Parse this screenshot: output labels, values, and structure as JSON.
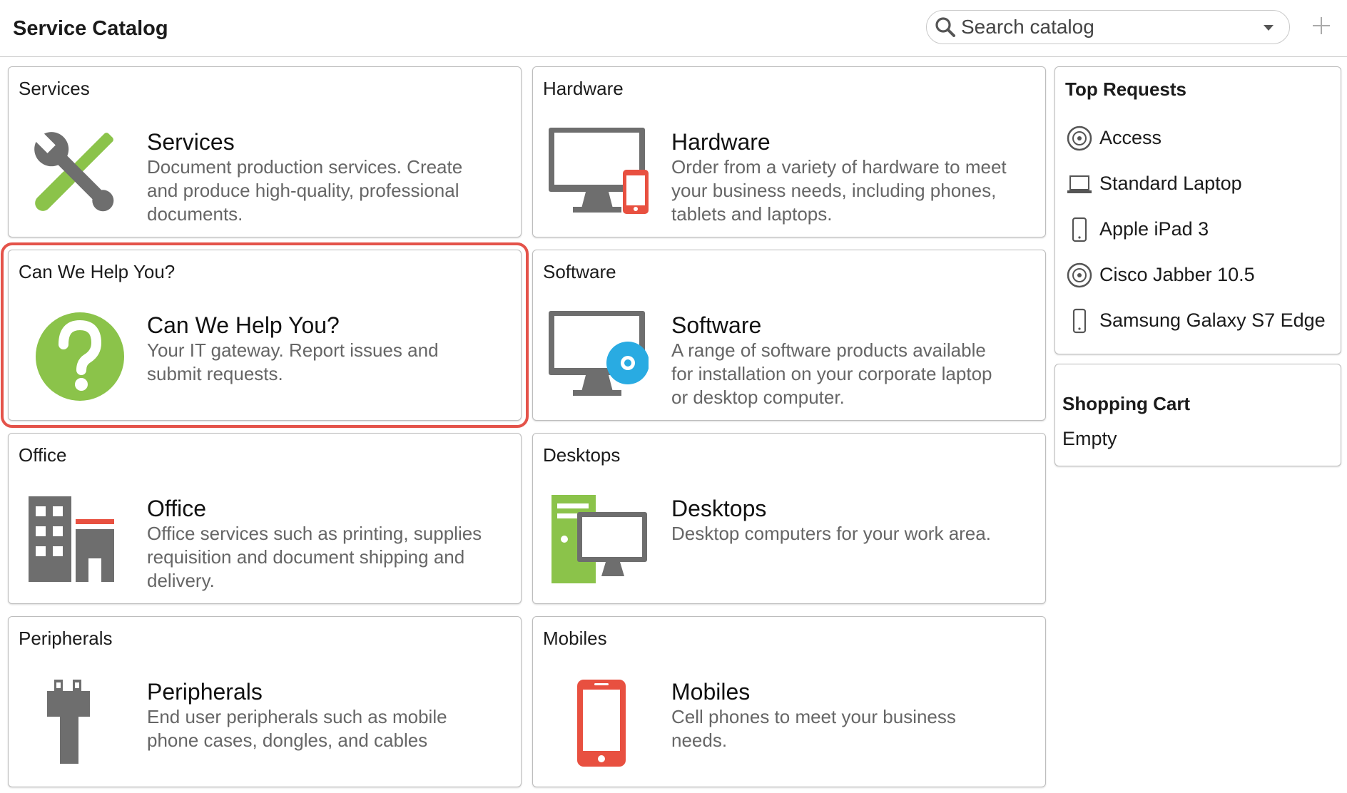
{
  "header": {
    "title": "Service Catalog",
    "search_placeholder": "Search catalog"
  },
  "categories": [
    {
      "header": "Services",
      "title": "Services",
      "description": "Document production services. Create and produce high-quality, professional documents."
    },
    {
      "header": "Hardware",
      "title": "Hardware",
      "description": "Order from a variety of hardware to meet your business needs, including phones, tablets and laptops."
    },
    {
      "header": "Can We Help You?",
      "title": "Can We Help You?",
      "description": "Your IT gateway. Report issues and submit requests."
    },
    {
      "header": "Software",
      "title": "Software",
      "description": "A range of software products available for installation on your corporate laptop or desktop computer."
    },
    {
      "header": "Office",
      "title": "Office",
      "description": "Office services such as printing, supplies requisition and document shipping and delivery."
    },
    {
      "header": "Desktops",
      "title": "Desktops",
      "description": "Desktop computers for your work area."
    },
    {
      "header": "Peripherals",
      "title": "Peripherals",
      "description": "End user peripherals such as mobile phone cases, dongles, and cables"
    },
    {
      "header": "Mobiles",
      "title": "Mobiles",
      "description": "Cell phones to meet your business needs."
    }
  ],
  "top_requests": {
    "title": "Top Requests",
    "items": [
      {
        "label": "Access",
        "icon": "disc-icon"
      },
      {
        "label": "Standard Laptop",
        "icon": "laptop-icon"
      },
      {
        "label": "Apple iPad 3",
        "icon": "tablet-icon"
      },
      {
        "label": "Cisco Jabber 10.5",
        "icon": "disc-icon"
      },
      {
        "label": "Samsung Galaxy S7 Edge",
        "icon": "phone-icon"
      }
    ]
  },
  "shopping_cart": {
    "title": "Shopping Cart",
    "status": "Empty"
  },
  "colors": {
    "accent_green": "#8bc34a",
    "accent_red": "#e85040",
    "accent_blue": "#29abe2",
    "icon_gray": "#6e6e6e",
    "selection_outline": "#e4534a"
  }
}
